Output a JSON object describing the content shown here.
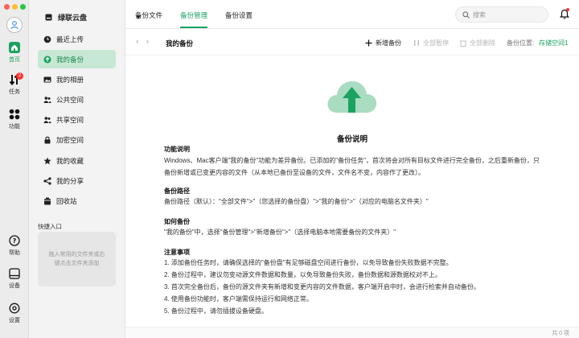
{
  "rail": {
    "home_label": "首页",
    "tasks_label": "任务",
    "tasks_badge": "2",
    "apps_label": "功能",
    "help_label": "帮助",
    "device_label": "设备",
    "settings_label": "设置"
  },
  "sidebar": {
    "drive_name": "绿联云盘",
    "items": [
      {
        "label": "最近上传",
        "icon": "clock-icon"
      },
      {
        "label": "我的备份",
        "icon": "backup-icon"
      },
      {
        "label": "我的相册",
        "icon": "album-icon"
      },
      {
        "label": "公共空间",
        "icon": "public-space-icon"
      },
      {
        "label": "共享空间",
        "icon": "shared-space-icon"
      },
      {
        "label": "加密空间",
        "icon": "lock-icon"
      },
      {
        "label": "我的收藏",
        "icon": "star-icon"
      },
      {
        "label": "我的分享",
        "icon": "share-icon"
      },
      {
        "label": "回收站",
        "icon": "trash-icon"
      }
    ],
    "active_index": 1,
    "quick_title": "快捷入口",
    "quick_hint": "拖入常用的文件夹或右键点击文件夹添加"
  },
  "topbar": {
    "tabs": [
      "备份文件",
      "备份管理",
      "备份设置"
    ],
    "active_tab": 1,
    "search_placeholder": "搜索"
  },
  "toolbar": {
    "breadcrumb": "我的备份",
    "add_label": "新增备份",
    "pause_all_label": "全部暂停",
    "delete_all_label": "全部删除",
    "location_label": "备份位置:",
    "location_value": "存储空间1"
  },
  "doc": {
    "title": "备份说明",
    "function_title": "功能说明",
    "function_body": "Windows、Mac客户端\"我的备份\"功能为差异备份。已添加的\"备份任务\"，首次将会对所有目标文件进行完全备份，之后重新备份，只备份新增或已变更内容的文件（从本地已备份至设备的文件，文件名不变，内容作了更改）。",
    "path_title": "备份路径",
    "path_body": "备份路径（默认）：\"全部文件\">\"（您选择的备份盘）\">\"我的备份\">\"（对应的电脑名文件夹）\"",
    "how_title": "如何备份",
    "how_body": "\"我的备份\"中，选择\"备份管理\">\"新增备份\">\"（选择电脑本地需要备份的文件夹）\"",
    "notes_title": "注意事项",
    "notes": [
      "1. 添加备份任务时，请确保选择的\"备份盘\"有足够磁盘空间进行备份，以免导致备份失败数据不完整。",
      "2. 备份过程中，建议勿变动源文件数据和数量，以免导致备份失败，备份数据和源数据校对不上。",
      "3. 首次完全备份后，备份的源文件夹有新增和变更内容的文件数据，客户端开启中时，会进行检索并自动备份。",
      "4. 使用备份功能时，客户端需保持运行和网络正常。",
      "5. 备份过程中，请勿插拔设备硬盘。"
    ]
  },
  "status": {
    "item_count": "共 0 项"
  },
  "colors": {
    "accent": "#1aa260",
    "active_bg": "#c7e8d4"
  }
}
